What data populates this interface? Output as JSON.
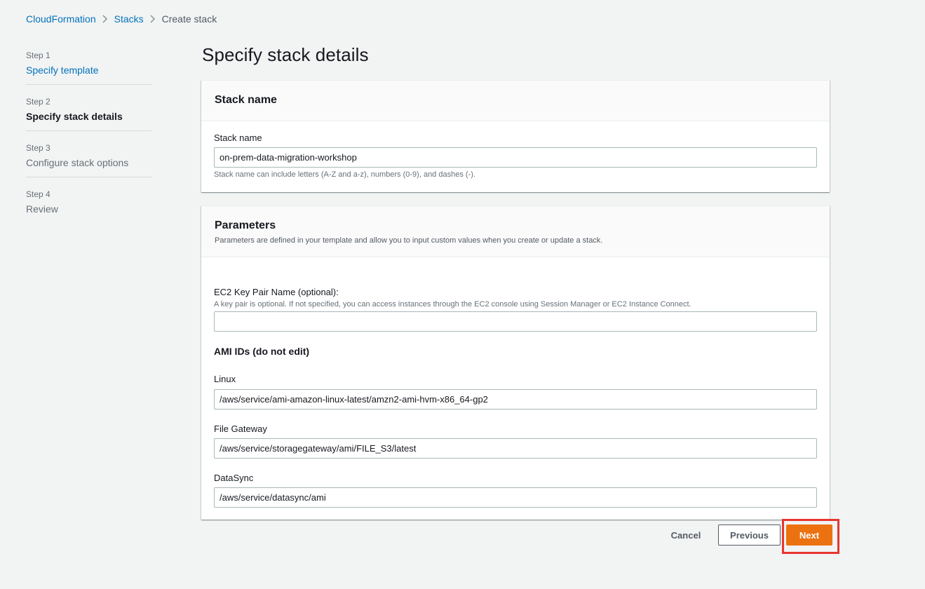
{
  "breadcrumb": {
    "items": [
      "CloudFormation",
      "Stacks"
    ],
    "current": "Create stack"
  },
  "steps": [
    {
      "num": "Step 1",
      "title": "Specify template",
      "state": "link"
    },
    {
      "num": "Step 2",
      "title": "Specify stack details",
      "state": "active"
    },
    {
      "num": "Step 3",
      "title": "Configure stack options",
      "state": "disabled"
    },
    {
      "num": "Step 4",
      "title": "Review",
      "state": "disabled"
    }
  ],
  "page_title": "Specify stack details",
  "stack_name_panel": {
    "header": "Stack name",
    "label": "Stack name",
    "value": "on-prem-data-migration-workshop",
    "hint": "Stack name can include letters (A-Z and a-z), numbers (0-9), and dashes (-)."
  },
  "parameters_panel": {
    "header": "Parameters",
    "description": "Parameters are defined in your template and allow you to input custom values when you create or update a stack.",
    "key_pair": {
      "label": "EC2 Key Pair Name (optional):",
      "description": "A key pair is optional. If not specified, you can access instances through the EC2 console using Session Manager or EC2 Instance Connect.",
      "value": ""
    },
    "ami_section_title": "AMI IDs (do not edit)",
    "linux": {
      "label": "Linux",
      "value": "/aws/service/ami-amazon-linux-latest/amzn2-ami-hvm-x86_64-gp2"
    },
    "file_gateway": {
      "label": "File Gateway",
      "value": "/aws/service/storagegateway/ami/FILE_S3/latest"
    },
    "datasync": {
      "label": "DataSync",
      "value": "/aws/service/datasync/ami"
    }
  },
  "buttons": {
    "cancel": "Cancel",
    "previous": "Previous",
    "next": "Next"
  },
  "colors": {
    "link": "#0073bb",
    "primary_button": "#ec7211",
    "highlight": "#e8352f",
    "background": "#f2f3f3"
  },
  "icons": {
    "breadcrumb_separator": "chevron-right-icon"
  }
}
